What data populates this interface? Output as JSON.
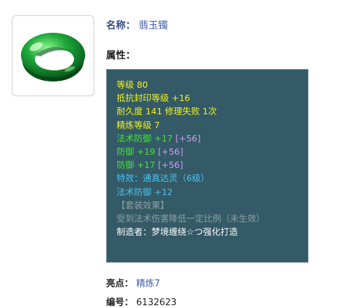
{
  "item": {
    "name_label": "名称：",
    "name_value": "翡玉镯",
    "icon": "jade-bracelet-icon"
  },
  "attributes": {
    "title": "属性：",
    "lines": [
      {
        "main": "等级 80",
        "bonus": "",
        "color": "#f3f21f"
      },
      {
        "main": "抵抗封印等级 +16",
        "bonus": "",
        "color": "#f3f21f"
      },
      {
        "main": "耐久度 141 修理失败 1次",
        "bonus": "",
        "color": "#f3f21f"
      },
      {
        "main": "精炼等级 7",
        "bonus": "",
        "color": "#f3f21f"
      },
      {
        "main": "法术防御 +17",
        "bonus": "[+56]",
        "color": "#44e436"
      },
      {
        "main": "防御 +19",
        "bonus": "[+56]",
        "color": "#44e436"
      },
      {
        "main": "防御 +17",
        "bonus": "[+56]",
        "color": "#44e436"
      },
      {
        "main": "特效：通真达灵（6级）",
        "bonus": "",
        "color": "#4ec1ee"
      },
      {
        "main": "法术防御 +12",
        "bonus": "",
        "color": "#4ec1ee"
      },
      {
        "main": "【套装效果】",
        "bonus": "",
        "color": "#8ea0a6"
      },
      {
        "main": "受到法术伤害降低一定比例（未生效）",
        "bonus": "",
        "color": "#8ea0a6"
      },
      {
        "main": "制造者：梦境缠绕☆つ强化打造",
        "bonus": "",
        "color": "#ffffff"
      }
    ]
  },
  "highlight": {
    "label": "亮点：",
    "value": "精炼7"
  },
  "serial": {
    "label": "编号：",
    "value": "6132623"
  }
}
